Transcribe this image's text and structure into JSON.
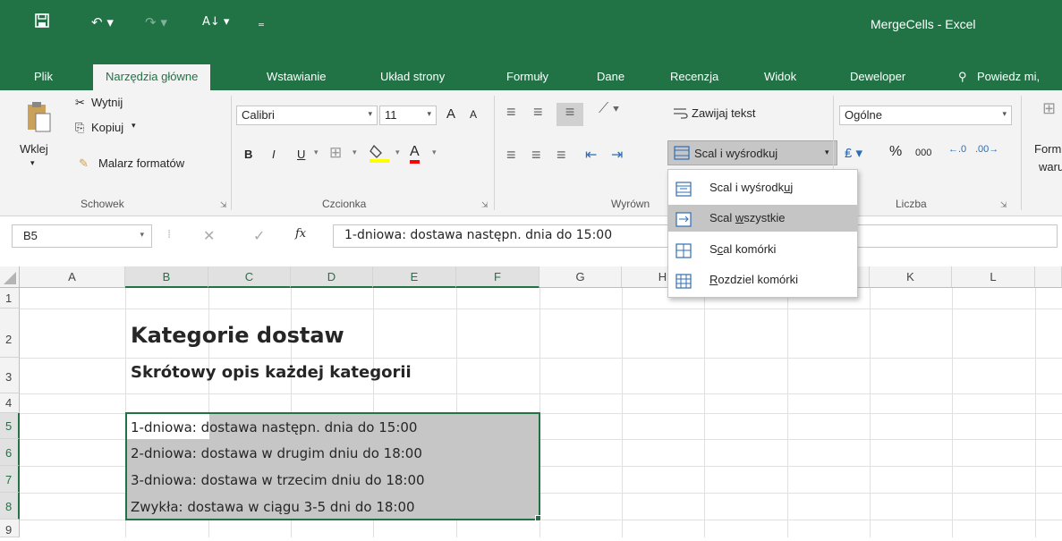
{
  "window": {
    "title": "MergeCells - Excel"
  },
  "tabs": [
    "Plik",
    "Narzędzia główne",
    "Wstawianie",
    "Układ strony",
    "Formuły",
    "Dane",
    "Recenzja",
    "Widok",
    "Deweloper",
    "Powiedz mi,"
  ],
  "clipboard": {
    "paste": "Wklej",
    "cut": "Wytnij",
    "copy": "Kopiuj",
    "painter": "Malarz formatów",
    "group": "Schowek"
  },
  "font": {
    "name": "Calibri",
    "size": "11",
    "bold": "B",
    "italic": "I",
    "underline": "U",
    "grow": "A",
    "shrink": "A",
    "color_letter": "A",
    "group": "Czcionka"
  },
  "alignment": {
    "wrap": "Zawijaj tekst",
    "merge": "Scal i wyśrodkuj",
    "group": "Wyrówn"
  },
  "number": {
    "format": "Ogólne",
    "percent": "%",
    "thousands": "000",
    "group": "Liczba"
  },
  "styles": {
    "cond_line1": "Form",
    "cond_line2": "waru"
  },
  "formula_bar": {
    "name_box": "B5",
    "fx": "fx",
    "content": "1-dniowa: dostawa następn. dnia do 15:00"
  },
  "columns": [
    "A",
    "B",
    "C",
    "D",
    "E",
    "F",
    "G",
    "H",
    "I",
    "J",
    "K",
    "L"
  ],
  "rows": [
    "1",
    "2",
    "3",
    "4",
    "5",
    "6",
    "7",
    "8",
    "9"
  ],
  "cells": {
    "b2": "Kategorie dostaw",
    "b3": "Skrótowy opis każdej kategorii",
    "b5": "1-dniowa: dostawa następn. dnia do 15:00",
    "b6": "2-dniowa: dostawa w drugim dniu do 18:00",
    "b7": "3-dniowa: dostawa w trzecim dniu do 18:00",
    "b8": "Zwykła: dostawa w ciągu 3-5 dni do 18:00"
  },
  "merge_menu": {
    "items": [
      {
        "pre": "Scal i wyśrodk",
        "key": "u",
        "post": "j"
      },
      {
        "pre": "Scal ",
        "key": "w",
        "post": "szystkie"
      },
      {
        "pre": "S",
        "key": "c",
        "post": "al komórki"
      },
      {
        "pre": "",
        "key": "R",
        "post": "ozdziel komórki"
      }
    ]
  },
  "colors": {
    "brand": "#217346",
    "selection": "#c6c6c6"
  }
}
